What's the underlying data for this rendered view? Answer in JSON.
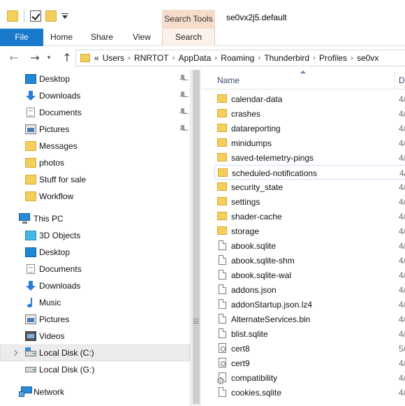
{
  "titlebar": {
    "search_tools_label": "Search Tools",
    "window_title": "se0vx2j5.default"
  },
  "ribbon": {
    "tabs": [
      {
        "label": "File"
      },
      {
        "label": "Home"
      },
      {
        "label": "Share"
      },
      {
        "label": "View"
      },
      {
        "label": "Search"
      }
    ]
  },
  "address": {
    "overflow": "«",
    "crumbs": [
      "Users",
      "RNRTOT",
      "AppData",
      "Roaming",
      "Thunderbird",
      "Profiles",
      "se0vx"
    ]
  },
  "navpane": {
    "quick_access": [
      {
        "label": "Desktop",
        "icon": "desktop-icon",
        "pinned": true
      },
      {
        "label": "Downloads",
        "icon": "download-icon",
        "pinned": true
      },
      {
        "label": "Documents",
        "icon": "documents-icon",
        "pinned": true
      },
      {
        "label": "Pictures",
        "icon": "pictures-icon",
        "pinned": true
      },
      {
        "label": "Messages",
        "icon": "folder-icon",
        "pinned": false
      },
      {
        "label": "photos",
        "icon": "folder-icon",
        "pinned": false
      },
      {
        "label": "Stuff for sale",
        "icon": "folder-icon",
        "pinned": false
      },
      {
        "label": "Workflow",
        "icon": "folder-icon",
        "pinned": false
      }
    ],
    "this_pc_label": "This PC",
    "this_pc_items": [
      {
        "label": "3D Objects",
        "icon": "3d-objects-icon"
      },
      {
        "label": "Desktop",
        "icon": "desktop-icon"
      },
      {
        "label": "Documents",
        "icon": "documents-icon"
      },
      {
        "label": "Downloads",
        "icon": "download-icon"
      },
      {
        "label": "Music",
        "icon": "music-icon"
      },
      {
        "label": "Pictures",
        "icon": "pictures-icon"
      },
      {
        "label": "Videos",
        "icon": "videos-icon"
      },
      {
        "label": "Local Disk (C:)",
        "icon": "local-disk-icon",
        "selected": true
      },
      {
        "label": "Local Disk (G:)",
        "icon": "local-disk-icon"
      }
    ],
    "network_label": "Network"
  },
  "filelist": {
    "col_name": "Name",
    "col_date": "D",
    "rows": [
      {
        "name": "calendar-data",
        "type": "folder",
        "date": "4/"
      },
      {
        "name": "crashes",
        "type": "folder",
        "date": "4/"
      },
      {
        "name": "datareporting",
        "type": "folder",
        "date": "4/"
      },
      {
        "name": "minidumps",
        "type": "folder",
        "date": "4/"
      },
      {
        "name": "saved-telemetry-pings",
        "type": "folder",
        "date": "4/"
      },
      {
        "name": "scheduled-notifications",
        "type": "folder",
        "date": "4/",
        "hover": true
      },
      {
        "name": "security_state",
        "type": "folder",
        "date": "4/"
      },
      {
        "name": "settings",
        "type": "folder",
        "date": "4/"
      },
      {
        "name": "shader-cache",
        "type": "folder",
        "date": "4/"
      },
      {
        "name": "storage",
        "type": "folder",
        "date": "4/"
      },
      {
        "name": "abook.sqlite",
        "type": "file",
        "date": "4/"
      },
      {
        "name": "abook.sqlite-shm",
        "type": "file",
        "date": "4/"
      },
      {
        "name": "abook.sqlite-wal",
        "type": "file",
        "date": "4/"
      },
      {
        "name": "addons.json",
        "type": "file",
        "date": "4/"
      },
      {
        "name": "addonStartup.json.lz4",
        "type": "file",
        "date": "4/"
      },
      {
        "name": "AlternateServices.bin",
        "type": "file",
        "date": "4/"
      },
      {
        "name": "blist.sqlite",
        "type": "file",
        "date": "4/"
      },
      {
        "name": "cert8",
        "type": "cert",
        "date": "5/"
      },
      {
        "name": "cert9",
        "type": "cert",
        "date": "4/"
      },
      {
        "name": "compatibility",
        "type": "gear",
        "date": "4/"
      },
      {
        "name": "cookies.sqlite",
        "type": "file",
        "date": "4/"
      }
    ]
  },
  "colors": {
    "file_tab": "#1979ca",
    "search_tools": "#f6dccb",
    "folder": "#f3cf5c",
    "selection": "#ececec"
  }
}
